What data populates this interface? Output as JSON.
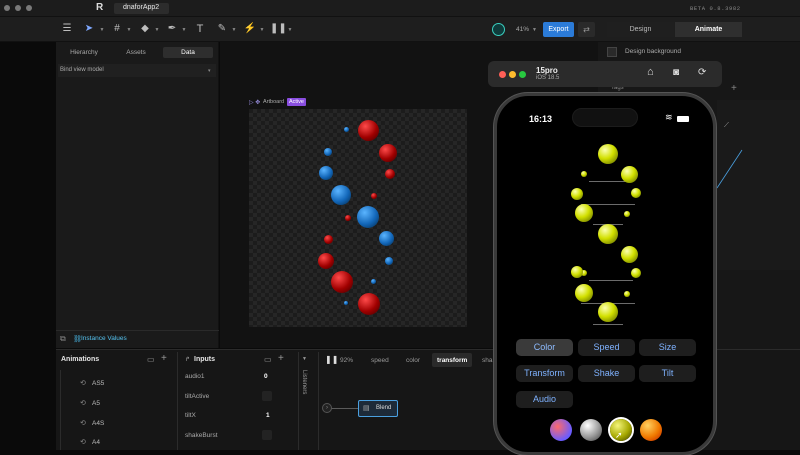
{
  "app": {
    "title": "dnaforApp2",
    "logo_letter": "R",
    "version": "BETA 0.8.3982"
  },
  "toolbar": {
    "zoom_label": "41%",
    "export_label": "Export",
    "mode_tabs": [
      "Design",
      "Animate"
    ],
    "active_mode": "Animate"
  },
  "left_panel": {
    "tabs": [
      "Hierarchy",
      "Assets",
      "Data"
    ],
    "active_tab": "Data",
    "bind_label": "Bind view model",
    "instance_label": "Instance Values"
  },
  "canvas": {
    "artboard_label": "Artboard",
    "active_badge": "Active"
  },
  "right_panel": {
    "design_background": "Design background",
    "tags_label": "Tags"
  },
  "simulator": {
    "device": "15pro",
    "os": "iOS 18.5",
    "time": "16:13",
    "buttons": [
      "Color",
      "Speed",
      "Size",
      "Transform",
      "Shake",
      "Tilt",
      "Audio"
    ],
    "selected_button": "Color",
    "swatch_colors": [
      "#6a5cff",
      "#bdbdbd",
      "#c6c800",
      "#f07a00"
    ]
  },
  "animations": {
    "header": "Animations",
    "items": [
      "AS5",
      "A5",
      "A4S",
      "A4"
    ]
  },
  "inputs": {
    "header": "Inputs",
    "items": [
      {
        "name": "audio1",
        "value": "0"
      },
      {
        "name": "tiltActive",
        "value": ""
      },
      {
        "name": "tiltX",
        "value": "1"
      },
      {
        "name": "shakeBurst",
        "value": ""
      }
    ]
  },
  "listeners": {
    "label": "Listeners"
  },
  "timeline": {
    "zoom": "92%",
    "tabs": [
      "speed",
      "color",
      "transform",
      "sha"
    ],
    "active_tab": "transform",
    "blend_label": "Blend"
  }
}
